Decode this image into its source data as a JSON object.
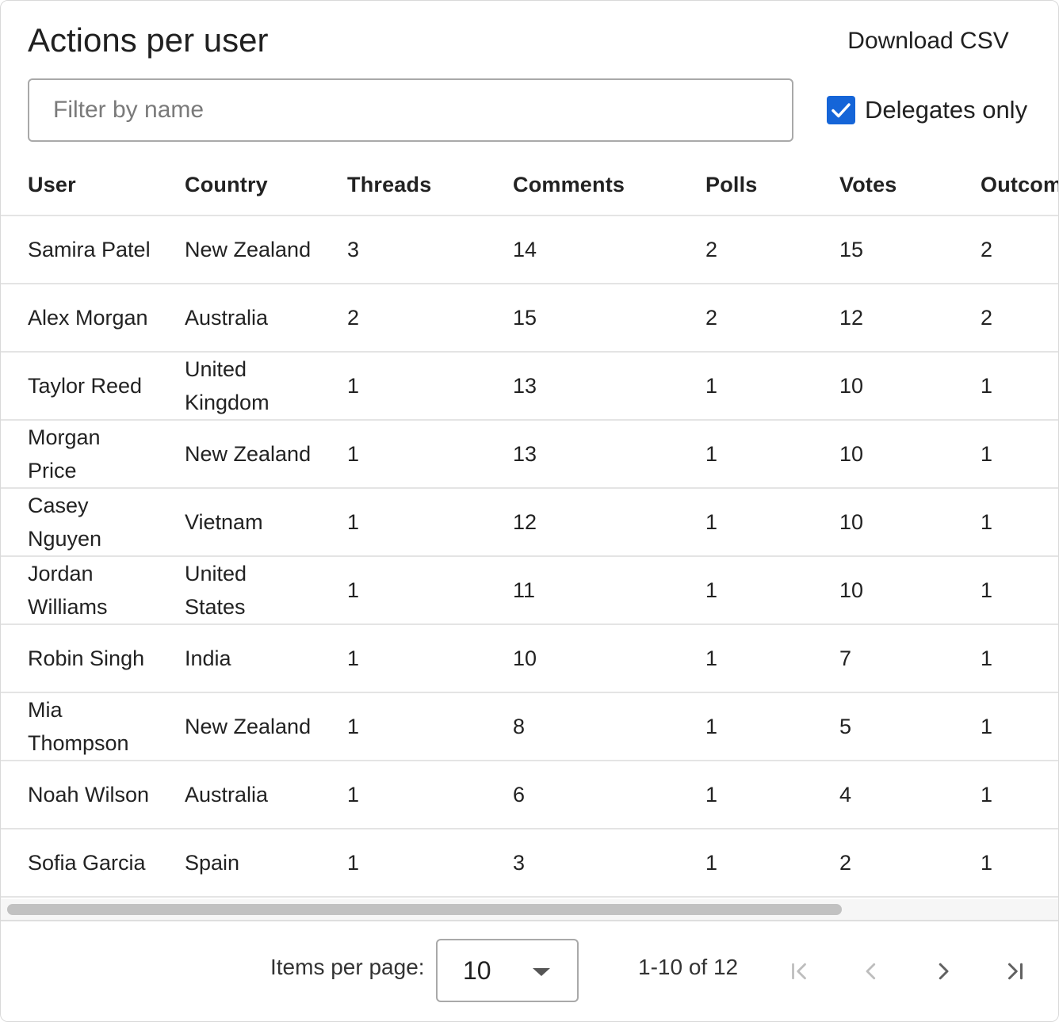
{
  "header": {
    "title": "Actions per user",
    "download_label": "Download CSV"
  },
  "filter": {
    "placeholder": "Filter by name",
    "value": ""
  },
  "delegates_only": {
    "label": "Delegates only",
    "checked": true
  },
  "table": {
    "columns": [
      "User",
      "Country",
      "Threads",
      "Comments",
      "Polls",
      "Votes",
      "Outcom"
    ],
    "rows": [
      {
        "user": "Samira Patel",
        "country": "New Zealand",
        "threads": "3",
        "comments": "14",
        "polls": "2",
        "votes": "15",
        "outcomes": "2"
      },
      {
        "user": "Alex Morgan",
        "country": "Australia",
        "threads": "2",
        "comments": "15",
        "polls": "2",
        "votes": "12",
        "outcomes": "2"
      },
      {
        "user": "Taylor Reed",
        "country": "United Kingdom",
        "threads": "1",
        "comments": "13",
        "polls": "1",
        "votes": "10",
        "outcomes": "1"
      },
      {
        "user": "Morgan Price",
        "country": "New Zealand",
        "threads": "1",
        "comments": "13",
        "polls": "1",
        "votes": "10",
        "outcomes": "1"
      },
      {
        "user": "Casey Nguyen",
        "country": "Vietnam",
        "threads": "1",
        "comments": "12",
        "polls": "1",
        "votes": "10",
        "outcomes": "1"
      },
      {
        "user": "Jordan Williams",
        "country": "United States",
        "threads": "1",
        "comments": "11",
        "polls": "1",
        "votes": "10",
        "outcomes": "1"
      },
      {
        "user": "Robin Singh",
        "country": "India",
        "threads": "1",
        "comments": "10",
        "polls": "1",
        "votes": "7",
        "outcomes": "1"
      },
      {
        "user": "Mia Thompson",
        "country": "New Zealand",
        "threads": "1",
        "comments": "8",
        "polls": "1",
        "votes": "5",
        "outcomes": "1"
      },
      {
        "user": "Noah Wilson",
        "country": "Australia",
        "threads": "1",
        "comments": "6",
        "polls": "1",
        "votes": "4",
        "outcomes": "1"
      },
      {
        "user": "Sofia Garcia",
        "country": "Spain",
        "threads": "1",
        "comments": "3",
        "polls": "1",
        "votes": "2",
        "outcomes": "1"
      }
    ]
  },
  "paginator": {
    "items_per_page_label": "Items per page:",
    "items_per_page_value": "10",
    "range_label": "1-10 of 12",
    "first_icon": "first-page-icon",
    "prev_icon": "chevron-left-icon",
    "next_icon": "chevron-right-icon",
    "last_icon": "last-page-icon"
  },
  "colors": {
    "accent": "#1565d8",
    "border": "#a9a9a9",
    "divider": "#e4e4e4",
    "disabled_icon": "#bdbdbd",
    "active_icon": "#616161"
  }
}
